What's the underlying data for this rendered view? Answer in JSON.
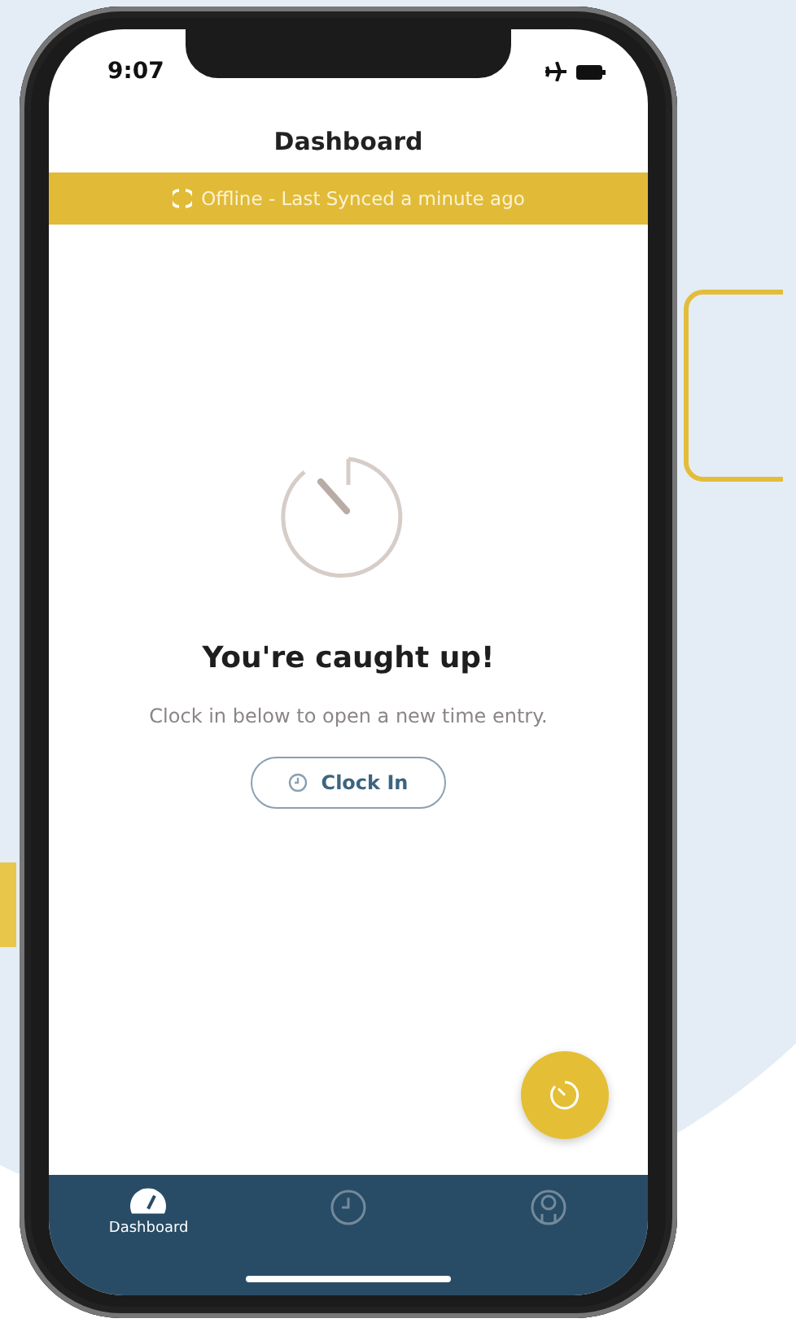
{
  "status_bar": {
    "time": "9:07"
  },
  "header": {
    "title": "Dashboard"
  },
  "banner": {
    "text": "Offline - Last Synced a minute ago"
  },
  "empty_state": {
    "heading": "You're caught up!",
    "message": "Clock in below to open a new time entry.",
    "button": "Clock In"
  },
  "tabs": [
    {
      "kind": "dashboard",
      "label": "Dashboard",
      "selected": true
    },
    {
      "kind": "clock",
      "selected": false
    },
    {
      "kind": "person",
      "selected": false
    }
  ]
}
